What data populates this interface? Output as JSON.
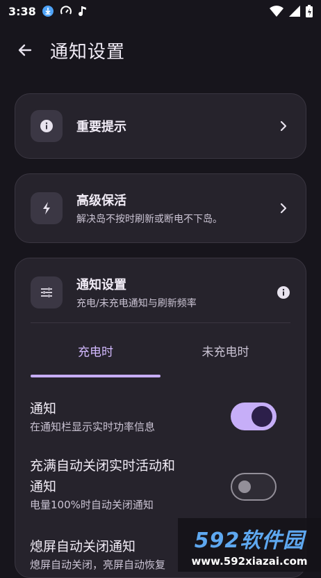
{
  "status_bar": {
    "time": "3:38",
    "icons_left": [
      "download-icon",
      "speedometer-icon",
      "music-note-icon"
    ],
    "icons_right": [
      "wifi-icon",
      "signal-icon",
      "battery-charging-icon"
    ]
  },
  "header": {
    "title": "通知设置"
  },
  "important_card": {
    "title": "重要提示"
  },
  "keepalive_card": {
    "title": "高级保活",
    "subtitle": "解决岛不按时刷新或断电不下岛。"
  },
  "notify_settings": {
    "title": "通知设置",
    "subtitle": "充电/未充电通知与刷新频率",
    "tabs": [
      {
        "label": "充电时",
        "active": true
      },
      {
        "label": "未充电时",
        "active": false
      }
    ],
    "items": [
      {
        "title": "通知",
        "desc": "在通知栏显示实时功率信息",
        "enabled": true
      },
      {
        "title_line1": "充满自动关闭实时活动和",
        "title_line2": "通知",
        "desc": "电量100%时自动关闭通知",
        "enabled": false
      },
      {
        "title": "熄屏自动关闭通知",
        "desc": "熄屏自动关闭，亮屏自动恢复"
      }
    ]
  },
  "watermark": {
    "brand": "592软件园",
    "url": "www.592xiazai.com"
  },
  "colors": {
    "accent": "#c6aef8",
    "background": "#17151c",
    "card": "#26232c"
  }
}
